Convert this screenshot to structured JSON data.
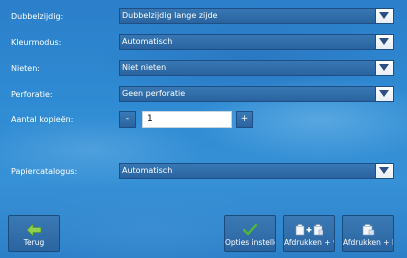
{
  "settings": {
    "duplex": {
      "label": "Dubbelzijdig:",
      "value": "Dubbelzijdig lange zijde"
    },
    "color_mode": {
      "label": "Kleurmodus:",
      "value": "Automatisch"
    },
    "staple": {
      "label": "Nieten:",
      "value": "Niet nieten"
    },
    "punch": {
      "label": "Perforatie:",
      "value": "Geen perforatie"
    },
    "copies": {
      "label": "Aantal kopieën:",
      "value": "1",
      "minus": "-",
      "plus": "+"
    },
    "paper_catalog": {
      "label": "Papiercatalogus:",
      "value": "Automatisch"
    }
  },
  "footer": {
    "back_label": "Terug",
    "set_options_label": "Opties instellen",
    "print_and_keep_label": "Afdrukken + v...",
    "print_and_delete_label": "Afdrukken + b..."
  },
  "icons": {
    "dropdown": "chevron-down-icon",
    "back": "arrow-left-icon",
    "confirm": "checkmark-icon",
    "print_keep": "print-plus-icon",
    "print_delete": "print-delete-icon"
  },
  "colors": {
    "background": "#2f8bd3",
    "control": "#2a64a0",
    "arrow_accent": "#2c4f86",
    "back_arrow": "#8fd14a",
    "checkmark": "#4fb83a"
  }
}
